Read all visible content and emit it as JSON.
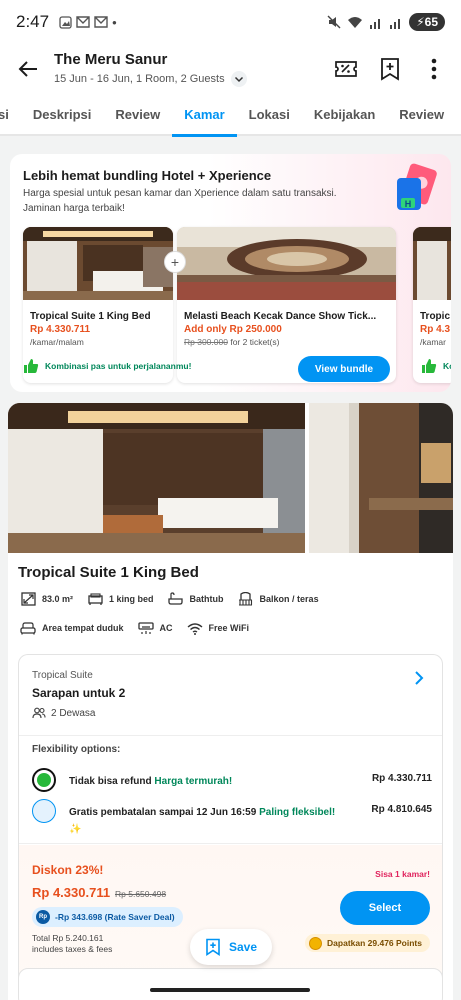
{
  "status": {
    "time": "2:47",
    "battery": "65"
  },
  "header": {
    "title": "The Meru Sanur",
    "subtitle": "15 Jun - 16 Jun, 1 Room, 2 Guests"
  },
  "tabs": [
    {
      "label": "si"
    },
    {
      "label": "Deskripsi"
    },
    {
      "label": "Review"
    },
    {
      "label": "Kamar"
    },
    {
      "label": "Lokasi"
    },
    {
      "label": "Kebijakan"
    },
    {
      "label": "Review"
    }
  ],
  "active_tab": "Kamar",
  "bundle": {
    "title": "Lebih hemat bundling Hotel + Xperience",
    "desc": "Harga spesial untuk pesan kamar dan Xperience dalam satu transaksi. Jaminan harga terbaik!",
    "cards": [
      {
        "name": "Tropical Suite 1 King Bed",
        "price": "Rp 4.330.711",
        "sub": "/kamar/malam"
      },
      {
        "name": "Melasti Beach Kecak Dance Show Tick...",
        "price": "Add only Rp 250.000",
        "strike": "Rp 300.000",
        "sub_suffix": "for 2 ticket(s)"
      },
      {
        "name": "Tropic",
        "price": "Rp 4.3",
        "sub": "/kamar"
      }
    ],
    "footer_text": "Kombinasi pas untuk perjalananmu!",
    "footer_text_2": "Ko",
    "view_button": "View bundle"
  },
  "room": {
    "name": "Tropical Suite 1 King Bed",
    "amenities_row1": [
      {
        "icon": "room-size-icon",
        "label": "83.0 m²"
      },
      {
        "icon": "bed-icon",
        "label": "1 king bed"
      },
      {
        "icon": "bathtub-icon",
        "label": "Bathtub"
      },
      {
        "icon": "balcony-icon",
        "label": "Balkon / teras"
      }
    ],
    "amenities_row2": [
      {
        "icon": "sofa-icon",
        "label": "Area tempat duduk"
      },
      {
        "icon": "ac-icon",
        "label": "AC"
      },
      {
        "icon": "wifi-icon",
        "label": "Free WiFi"
      }
    ]
  },
  "offer": {
    "type": "Tropical Suite",
    "title": "Sarapan untuk 2",
    "guests": "2 Dewasa",
    "flex_label": "Flexibility options:",
    "options": [
      {
        "text": "Tidak bisa refund",
        "tag": "Harga termurah!",
        "price": "Rp 4.330.711",
        "selected": true
      },
      {
        "text": "Gratis pembatalan sampai 12 Jun 16:59",
        "tag": "Paling fleksibel! ✨",
        "price": "Rp 4.810.645",
        "selected": false
      }
    ],
    "discount": "Diskon 23%!",
    "price": "Rp 4.330.711",
    "strike_price": "Rp 5.650.498",
    "saver": "-Rp 343.698 (Rate Saver Deal)",
    "total_line1": "Total Rp 5.240.161",
    "total_line2": "includes taxes & fees",
    "rooms_left": "Sisa 1 kamar!",
    "select": "Select",
    "points": "Dapatkan 29.476 Points"
  },
  "save_label": "Save",
  "colors": {
    "accent": "#0194f3",
    "price": "#e7501e",
    "green": "#00875a"
  }
}
